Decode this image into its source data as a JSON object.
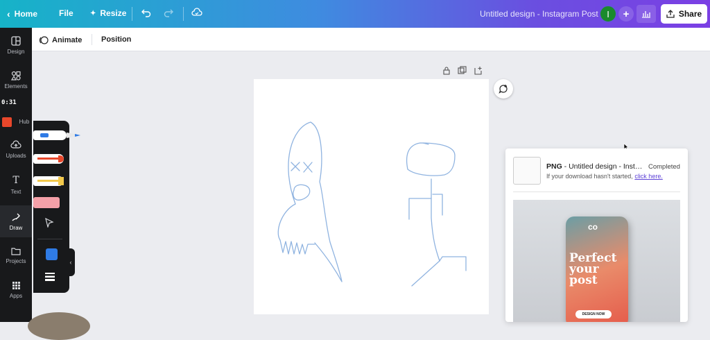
{
  "topbar": {
    "home_label": "Home",
    "file_label": "File",
    "resize_label": "Resize",
    "design_title": "Untitled design - Instagram Post",
    "avatar_initial": "I",
    "share_label": "Share"
  },
  "subbar": {
    "animate_label": "Animate",
    "position_label": "Position"
  },
  "rail": {
    "items": [
      {
        "label": "Design",
        "icon": "layout-icon"
      },
      {
        "label": "Elements",
        "icon": "shapes-icon"
      },
      {
        "label": "Hub",
        "icon": "hub-icon"
      },
      {
        "label": "Uploads",
        "icon": "cloud-upload-icon"
      },
      {
        "label": "Text",
        "icon": "text-icon"
      },
      {
        "label": "Draw",
        "icon": "draw-icon"
      },
      {
        "label": "Projects",
        "icon": "folder-icon"
      },
      {
        "label": "Apps",
        "icon": "apps-icon"
      }
    ],
    "timer": "0:31"
  },
  "draw_panel": {
    "pens": [
      {
        "name": "marker-blue",
        "color": "#2f7be5"
      },
      {
        "name": "marker-red",
        "color": "#e8472b"
      },
      {
        "name": "highlighter-yellow",
        "color": "#f2c94c"
      },
      {
        "name": "eraser",
        "color": "#f4a0a8"
      }
    ],
    "selected_color": "#2f7be5"
  },
  "download": {
    "format": "PNG",
    "filename": " - Untitled design - Insta...",
    "status": "Completed",
    "note": "If your download hasn't started,",
    "link": "click here.",
    "promo_logo": "co",
    "promo_headline": "Perfect your post",
    "promo_button": "DESIGN NOW"
  },
  "colors": {
    "accent": "#7b3fe4",
    "rail_bg": "#18191b",
    "stroke": "#8fb3e0"
  }
}
